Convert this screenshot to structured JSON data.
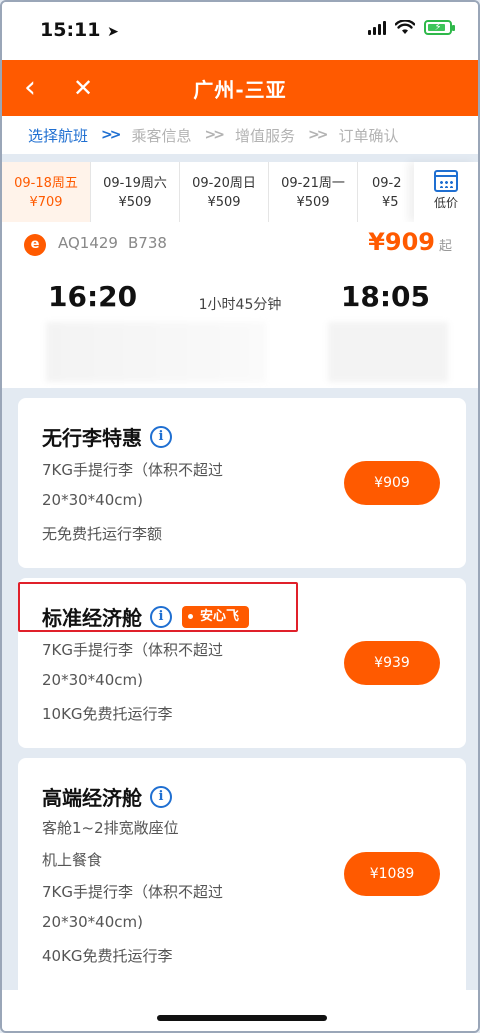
{
  "status": {
    "time": "15:11"
  },
  "nav": {
    "title": "广州-三亚"
  },
  "steps": [
    "选择航班",
    "乘客信息",
    "增值服务",
    "订单确认"
  ],
  "dates": [
    {
      "date": "09-18周五",
      "price": "¥709"
    },
    {
      "date": "09-19周六",
      "price": "¥509"
    },
    {
      "date": "09-20周日",
      "price": "¥509"
    },
    {
      "date": "09-21周一",
      "price": "¥509"
    },
    {
      "date": "09-2",
      "price": "¥5"
    }
  ],
  "lowprice_label": "低价",
  "flight": {
    "airline_logo": "e",
    "number": "AQ1429",
    "aircraft": "B738",
    "price": "¥909",
    "price_suffix": "起",
    "depart_time": "16:20",
    "arrive_time": "18:05",
    "duration": "1小时45分钟"
  },
  "cabins": [
    {
      "title": "无行李特惠",
      "lines": [
        "7KG手提行李（体积不超过",
        "20*30*40cm)",
        "无免费托运行李额"
      ],
      "price": "¥909"
    },
    {
      "title": "标准经济舱",
      "tag": "安心飞",
      "lines": [
        "7KG手提行李（体积不超过",
        "20*30*40cm)",
        "10KG免费托运行李"
      ],
      "price": "¥939"
    },
    {
      "title": "高端经济舱",
      "lines": [
        "客舱1~2排宽敞座位",
        "机上餐食",
        "7KG手提行李（体积不超过",
        "20*30*40cm)",
        "40KG免费托运行李"
      ],
      "price": "¥1089"
    }
  ],
  "colors": {
    "accent": "#ff5a00",
    "link": "#1f6fd1",
    "highlight": "#e0202a"
  }
}
